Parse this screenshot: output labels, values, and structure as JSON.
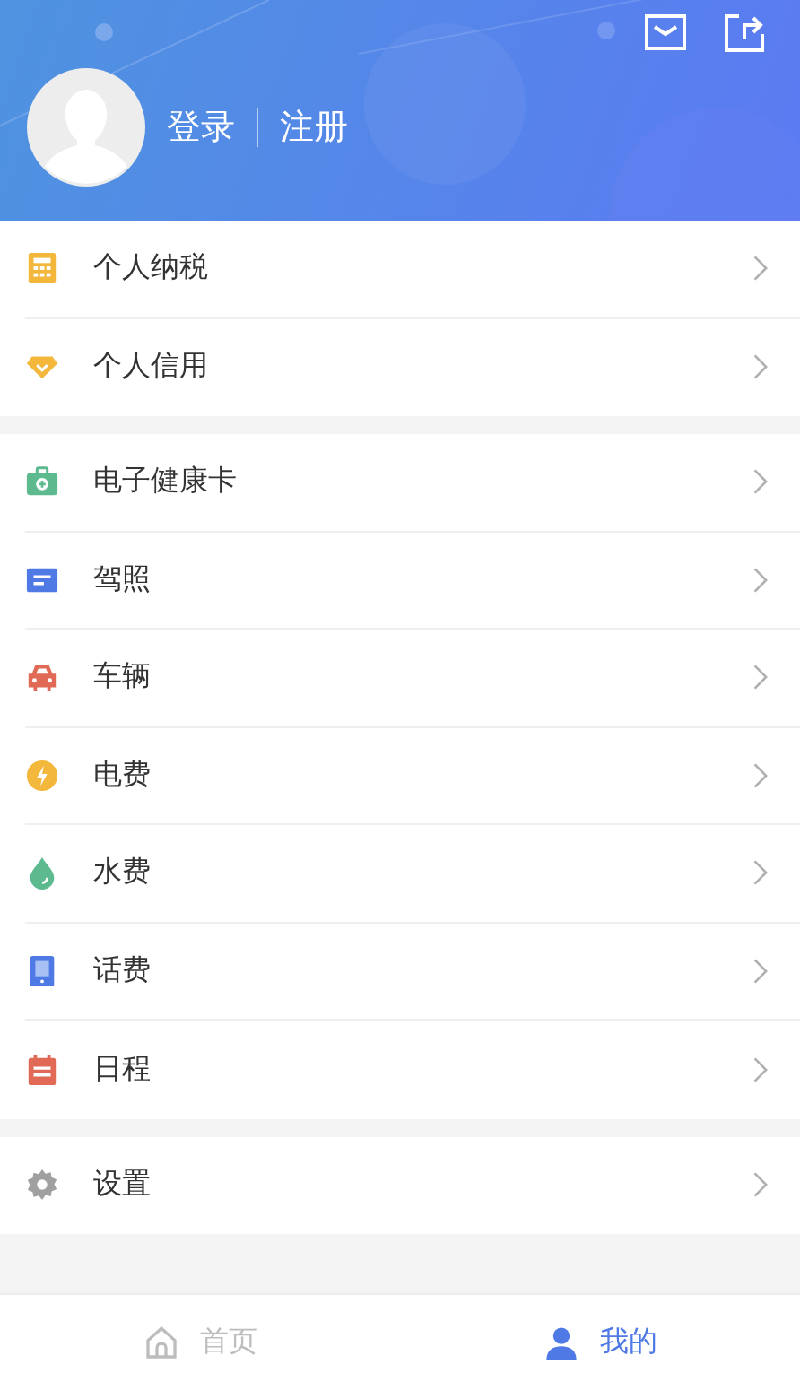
{
  "header": {
    "login": "登录",
    "register": "注册"
  },
  "groups": [
    {
      "items": [
        {
          "label": "个人纳税"
        },
        {
          "label": "个人信用"
        }
      ]
    },
    {
      "items": [
        {
          "label": "电子健康卡"
        },
        {
          "label": "驾照"
        },
        {
          "label": "车辆"
        },
        {
          "label": "电费"
        },
        {
          "label": "水费"
        },
        {
          "label": "话费"
        },
        {
          "label": "日程"
        }
      ]
    },
    {
      "items": [
        {
          "label": "设置"
        }
      ]
    }
  ],
  "tabs": [
    {
      "label": "首页",
      "selected": false
    },
    {
      "label": "我的",
      "selected": true
    }
  ]
}
